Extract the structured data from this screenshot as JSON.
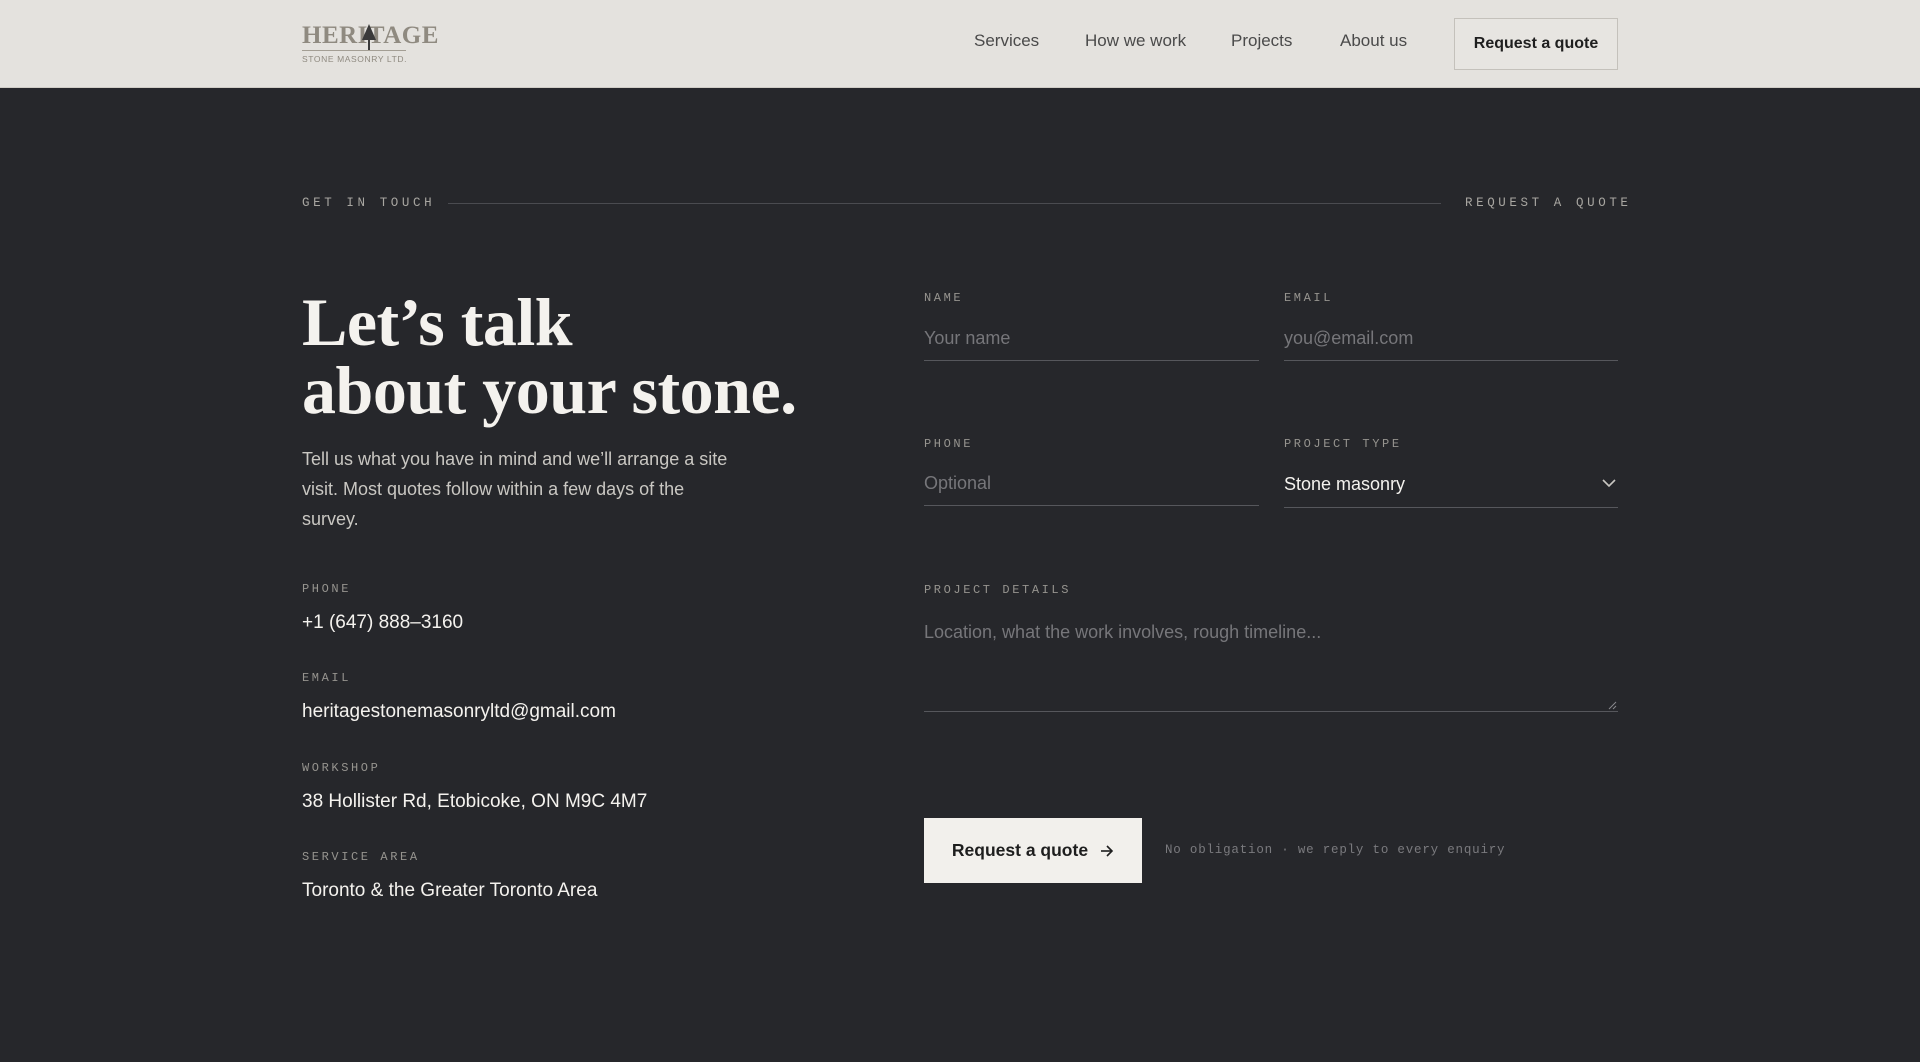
{
  "header": {
    "logo_word": "HERITAGE",
    "logo_sub": "STONE MASONRY LTD.",
    "nav": [
      "Services",
      "How we work",
      "Projects",
      "About us"
    ],
    "cta": "Request a quote"
  },
  "section": {
    "eyebrow_left": "GET IN TOUCH",
    "eyebrow_right": "REQUEST A QUOTE"
  },
  "intro": {
    "headline_line1": "Let’s talk",
    "headline_line2": "about your stone.",
    "body": "Tell us what you have in mind and we’ll arrange a site visit. Most quotes follow within a few days of the survey."
  },
  "contact": {
    "phone_label": "PHONE",
    "phone": "+1 (647) 888–3160",
    "email_label": "EMAIL",
    "email": "heritagestonemasonryltd@gmail.com",
    "workshop_label": "WORKSHOP",
    "workshop": "38 Hollister Rd, Etobicoke, ON M9C 4M7",
    "area_label": "SERVICE AREA",
    "area": "Toronto & the Greater Toronto Area"
  },
  "form": {
    "name_label": "NAME",
    "name_placeholder": "Your name",
    "email_label": "EMAIL",
    "email_placeholder": "you@email.com",
    "phone_label": "PHONE",
    "phone_placeholder": "Optional",
    "type_label": "PROJECT TYPE",
    "type_value": "Stone masonry",
    "details_label": "PROJECT DETAILS",
    "details_placeholder": "Location, what the work involves, rough timeline...",
    "submit_label": "Request a quote",
    "submit_note": "No obligation · we reply to every enquiry"
  },
  "colors": {
    "background": "#26272b",
    "header": "#e4e2de",
    "button": "#f2f0ec"
  },
  "icons": [
    "tree-icon",
    "chevron-down-icon",
    "arrow-right-icon",
    "resize-grip-icon"
  ]
}
